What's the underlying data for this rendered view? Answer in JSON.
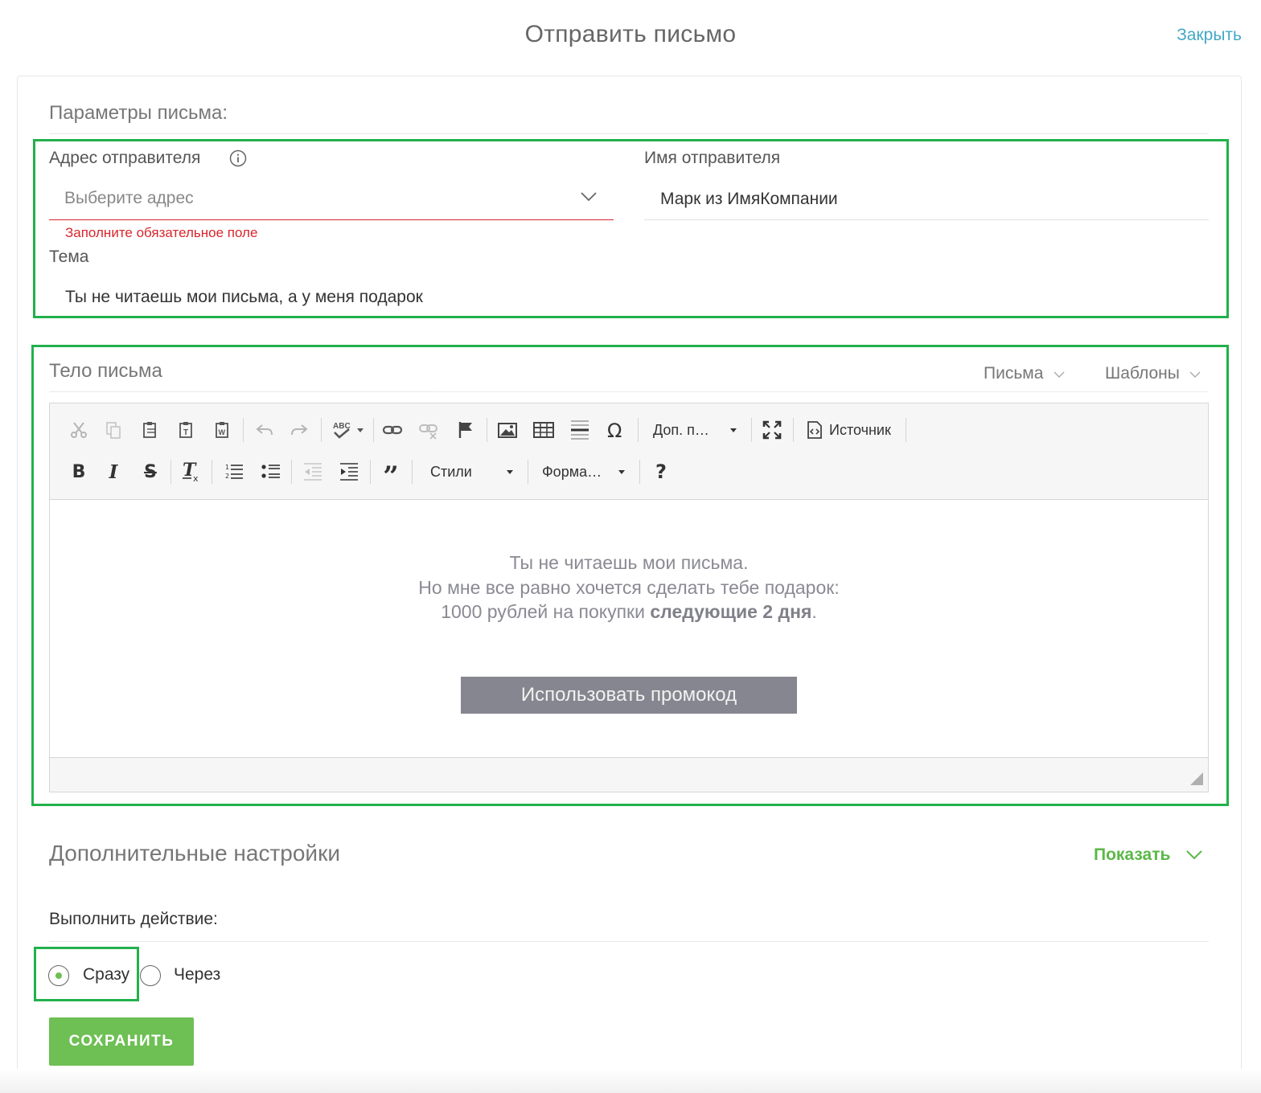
{
  "header": {
    "title": "Отправить письмо",
    "close_label": "Закрыть"
  },
  "params": {
    "section_title": "Параметры письма:",
    "sender_address_label": "Адрес отправителя",
    "sender_address_placeholder": "Выберите адрес",
    "sender_address_error": "Заполните обязательное поле",
    "sender_name_label": "Имя отправителя",
    "sender_name_value": "Марк из ИмяКомпании",
    "subject_label": "Тема",
    "subject_value": "Ты не читаешь мои письма, а у меня подарок"
  },
  "body": {
    "section_title": "Тело письма",
    "letters_dropdown": "Письма",
    "templates_dropdown": "Шаблоны",
    "toolbar": {
      "more_combo": "Доп. п…",
      "source_label": "Источник",
      "styles_combo": "Стили",
      "format_combo": "Форма…",
      "help_label": "?",
      "spell_label": "ABC"
    },
    "content": {
      "line1": "Ты не читаешь мои письма.",
      "line2": "Но мне все равно хочется сделать тебе подарок:",
      "line3_prefix": "1000 рублей на покупки ",
      "line3_bold": "следующие 2 дня",
      "line3_suffix": ".",
      "button_label": "Использовать промокод"
    }
  },
  "extra": {
    "section_title": "Дополнительные настройки",
    "toggle_label": "Показать"
  },
  "action": {
    "label": "Выполнить действие:",
    "options": [
      {
        "label": "Сразу",
        "selected": true
      },
      {
        "label": "Через",
        "selected": false
      }
    ]
  },
  "save_label": "СОХРАНИТЬ",
  "colors": {
    "accent_green": "#6ebf54",
    "highlight_green": "#22b14c",
    "link_blue": "#45a8c7",
    "error_red": "#d9262c"
  }
}
